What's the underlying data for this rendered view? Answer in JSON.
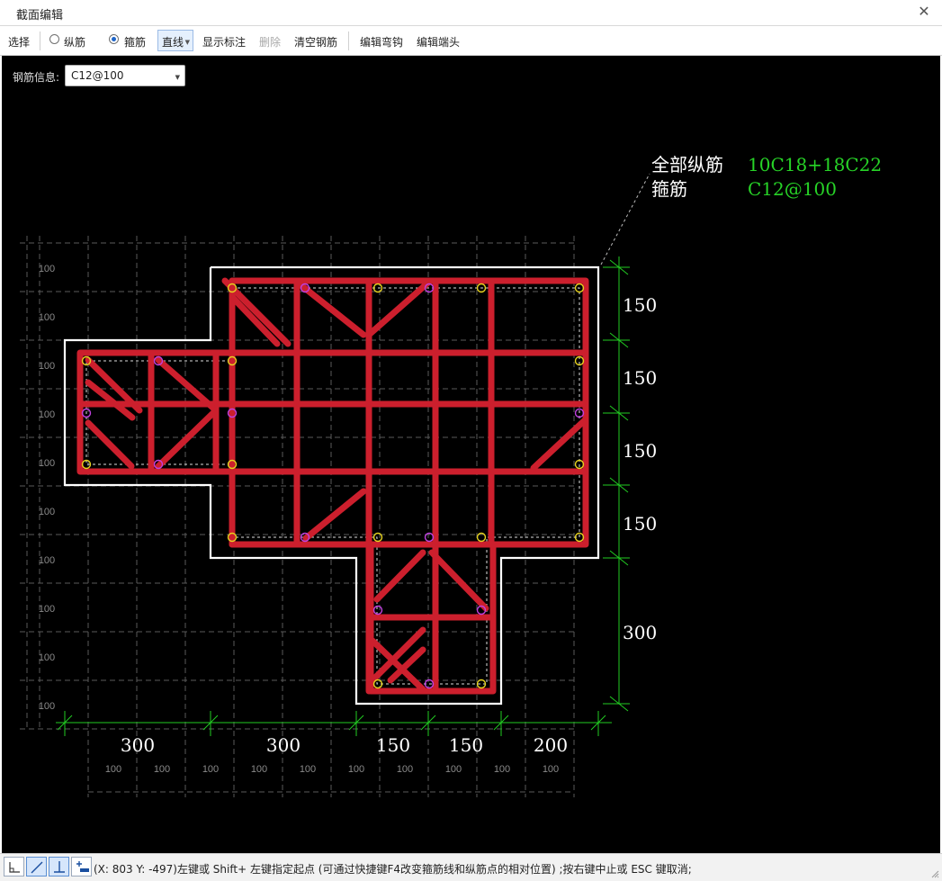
{
  "window": {
    "title": "截面编辑"
  },
  "toolbar": {
    "select_label": "选择",
    "longitudinal_label": "纵筋",
    "stirrup_label": "箍筋",
    "line_mode_label": "直线",
    "show_dims_label": "显示标注",
    "delete_label": "删除",
    "clear_rebar_label": "清空钢筋",
    "edit_hook_label": "编辑弯钩",
    "edit_end_label": "编辑端头",
    "selected_mode": "stirrup"
  },
  "rebar_info": {
    "label": "钢筋信息:",
    "value": "C12@100"
  },
  "annotation": {
    "longitudinal_title": "全部纵筋",
    "longitudinal_value": "10C18+18C22",
    "stirrup_title": "箍筋",
    "stirrup_value": "C12@100"
  },
  "grid": {
    "minor_label": "100",
    "rows": 10,
    "cols": 10
  },
  "dimensions": {
    "vertical": [
      "150",
      "150",
      "150",
      "150",
      "300"
    ],
    "horizontal": [
      "300",
      "300",
      "150",
      "150",
      "200"
    ]
  },
  "colors": {
    "background": "#000000",
    "outline": "#ffffff",
    "stirrup": "#cc1f2d",
    "dimension": "#22cc22",
    "annotation_value": "#27d327",
    "rebar_yellow": "#e6d21e",
    "rebar_purple": "#c040e0",
    "grid": "#5a5a5a"
  },
  "status": {
    "text": "(X: 803 Y: -497)左键或 Shift+ 左键指定起点 (可通过快捷键F4改变箍筋线和纵筋点的相对位置) ;按右键中止或 ESC 键取消;",
    "buttons": [
      "orthogonal-icon",
      "oblique-icon",
      "perpendicular-icon",
      "add-stirrup-icon"
    ]
  }
}
